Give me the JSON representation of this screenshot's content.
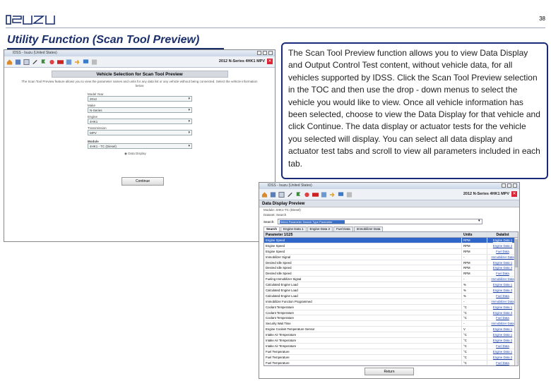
{
  "slide": {
    "page_number": "38",
    "heading": "Utility Function (Scan Tool Preview)",
    "description": "The Scan Tool Preview function allows you to view Data Display and Output Control Test content, without vehicle data, for all vehicles supported by IDSS. Click the Scan Tool Preview selection in the TOC and then use the drop - down menus to select the vehicle you would like to view. Once all vehicle information has been selected, choose to view the Data Display for that vehicle and click Continue. The data display or actuator tests for the vehicle you selected will display. You can select all data display and actuator test tabs and scroll to view all parameters included in each tab.",
    "logo_color": "#1a2f6b"
  },
  "window1": {
    "titlebar": "IDSS - Isuzu (United States)",
    "vehicle_info": "2012 N-Series 4HK1 MPV",
    "panel_title": "Vehicle Selection for Scan Tool Preview",
    "panel_desc": "The Scan Tool Preview feature allows you to view the parameter names and units for any data list or any vehicle without being connected. Select the vehicle information below",
    "fields": [
      {
        "label": "Model Year",
        "value": "2012"
      },
      {
        "label": "Make",
        "value": "N-Series"
      },
      {
        "label": "Engine",
        "value": "4HK1"
      },
      {
        "label": "Transmission",
        "value": "MPV"
      },
      {
        "label": "Module",
        "value": "4HK1 - TC (Diesel)"
      }
    ],
    "radio_label": "Data Display",
    "continue_label": "Continue"
  },
  "window2": {
    "titlebar": "IDSS - Isuzu (United States)",
    "vehicle_info": "2012 N-Series 4HK1 MPV",
    "title": "Data Display Preview",
    "meta": [
      "Module: 4HK1-TC (Diesel)",
      "Dataset: Search"
    ],
    "search_label": "Search:",
    "search_value": "Select Parameter Search Type Parameter",
    "tabs": [
      "Search",
      "Engine Data 1",
      "Engine Data 2",
      "Fuel Data",
      "Immobilizer Data"
    ],
    "columns": [
      "Parameter 1/125",
      "Units",
      "Datalist"
    ],
    "rows": [
      {
        "p": "Engine Speed",
        "u": "RPM",
        "d": "Engine Data 1",
        "sel": true
      },
      {
        "p": "Engine Speed",
        "u": "RPM",
        "d": "Engine Data 2"
      },
      {
        "p": "Engine Speed",
        "u": "RPM",
        "d": "Fuel Data"
      },
      {
        "p": "Immobilizer Signal",
        "u": "-",
        "d": "Immobilizer Data"
      },
      {
        "p": "Desired Idle Speed",
        "u": "RPM",
        "d": "Engine Data 1"
      },
      {
        "p": "Desired Idle Speed",
        "u": "RPM",
        "d": "Engine Data 2"
      },
      {
        "p": "Desired Idle Speed",
        "u": "RPM",
        "d": "Fuel Data"
      },
      {
        "p": "Fueling Immobilizer Signal",
        "u": "-",
        "d": "Immobilizer Data"
      },
      {
        "p": "Calculated Engine Load",
        "u": "%",
        "d": "Engine Data 1"
      },
      {
        "p": "Calculated Engine Load",
        "u": "%",
        "d": "Engine Data 2"
      },
      {
        "p": "Calculated Engine Load",
        "u": "%",
        "d": "Fuel Data"
      },
      {
        "p": "Immobilizer Function Programmed",
        "u": "-",
        "d": "Immobilizer Data"
      },
      {
        "p": "Coolant Temperature",
        "u": "°C",
        "d": "Engine Data 1"
      },
      {
        "p": "Coolant Temperature",
        "u": "°C",
        "d": "Engine Data 2"
      },
      {
        "p": "Coolant Temperature",
        "u": "°C",
        "d": "Fuel Data"
      },
      {
        "p": "Security Wait Time",
        "u": "-",
        "d": "Immobilizer Data"
      },
      {
        "p": "Engine Coolant Temperature Sensor",
        "u": "V",
        "d": "Engine Data 1"
      },
      {
        "p": "Intake Air Temperature",
        "u": "°C",
        "d": "Engine Data 1"
      },
      {
        "p": "Intake Air Temperature",
        "u": "°C",
        "d": "Engine Data 2"
      },
      {
        "p": "Intake Air Temperature",
        "u": "°C",
        "d": "Fuel Data"
      },
      {
        "p": "Fuel Temperature",
        "u": "°C",
        "d": "Engine Data 1"
      },
      {
        "p": "Fuel Temperature",
        "u": "°C",
        "d": "Engine Data 2"
      },
      {
        "p": "Fuel Temperature",
        "u": "°C",
        "d": "Fuel Data"
      }
    ],
    "return_label": "Return"
  }
}
